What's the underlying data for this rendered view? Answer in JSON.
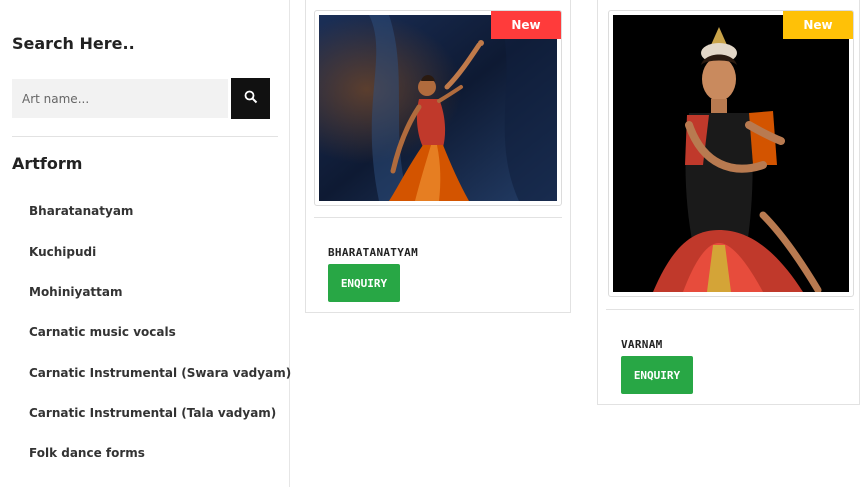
{
  "sidebar": {
    "search_title": "Search Here..",
    "search_placeholder": "Art name...",
    "search_icon": "search-icon",
    "artform_title": "Artform",
    "artforms": [
      "Bharatanatyam",
      "Kuchipudi",
      "Mohiniyattam",
      "Carnatic music vocals",
      "Carnatic Instrumental (Swara vadyam)",
      "Carnatic Instrumental (Tala vadyam)",
      "Folk dance forms"
    ]
  },
  "products": [
    {
      "badge": "New",
      "badge_color": "#ff3b3b",
      "name": "BHARATANATYAM",
      "button": "ENQUIRY"
    },
    {
      "badge": "New",
      "badge_color": "#ffc107",
      "name": "VARNAM",
      "button": "ENQUIRY"
    }
  ],
  "colors": {
    "button_green": "#28a745",
    "search_button": "#111111"
  }
}
